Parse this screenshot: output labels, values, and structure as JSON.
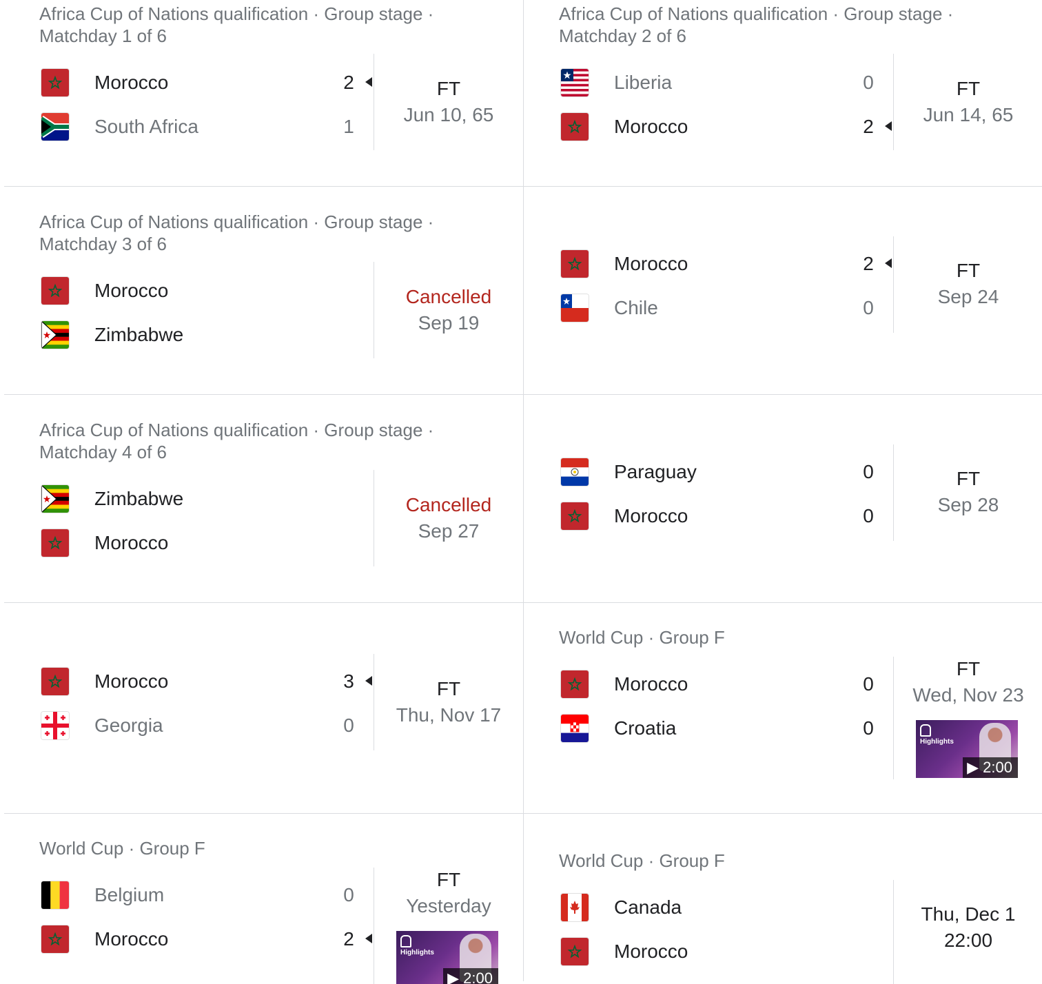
{
  "matches": [
    {
      "header_line1": "Africa Cup of Nations qualification · Group stage ·",
      "header_line2": "Matchday 1 of 6",
      "teams": [
        {
          "name": "Morocco",
          "score": "2",
          "flag": "morocco-flag",
          "winner": true
        },
        {
          "name": "South Africa",
          "score": "1",
          "flag": "south-africa-flag",
          "winner": false
        }
      ],
      "status": "FT",
      "date": "Jun 10, 65"
    },
    {
      "header_line1": "Africa Cup of Nations qualification · Group stage ·",
      "header_line2": "Matchday 2 of 6",
      "teams": [
        {
          "name": "Liberia",
          "score": "0",
          "flag": "liberia-flag",
          "winner": false
        },
        {
          "name": "Morocco",
          "score": "2",
          "flag": "morocco-flag",
          "winner": true
        }
      ],
      "status": "FT",
      "date": "Jun 14, 65"
    },
    {
      "header_line1": "Africa Cup of Nations qualification · Group stage ·",
      "header_line2": "Matchday 3 of 6",
      "teams": [
        {
          "name": "Morocco",
          "flag": "morocco-flag"
        },
        {
          "name": "Zimbabwe",
          "flag": "zimbabwe-flag"
        }
      ],
      "status": "Cancelled",
      "date": "Sep 19"
    },
    {
      "teams": [
        {
          "name": "Morocco",
          "score": "2",
          "flag": "morocco-flag",
          "winner": true
        },
        {
          "name": "Chile",
          "score": "0",
          "flag": "chile-flag",
          "winner": false
        }
      ],
      "status": "FT",
      "date": "Sep 24"
    },
    {
      "header_line1": "Africa Cup of Nations qualification · Group stage ·",
      "header_line2": "Matchday 4 of 6",
      "teams": [
        {
          "name": "Zimbabwe",
          "flag": "zimbabwe-flag"
        },
        {
          "name": "Morocco",
          "flag": "morocco-flag"
        }
      ],
      "status": "Cancelled",
      "date": "Sep 27"
    },
    {
      "teams": [
        {
          "name": "Paraguay",
          "score": "0",
          "flag": "paraguay-flag",
          "winner": false
        },
        {
          "name": "Morocco",
          "score": "0",
          "flag": "morocco-flag",
          "winner": false
        }
      ],
      "status": "FT",
      "date": "Sep 28"
    },
    {
      "teams": [
        {
          "name": "Morocco",
          "score": "3",
          "flag": "morocco-flag",
          "winner": true
        },
        {
          "name": "Georgia",
          "score": "0",
          "flag": "georgia-flag",
          "winner": false
        }
      ],
      "status": "FT",
      "date": "Thu, Nov 17"
    },
    {
      "header_line1": "World Cup · Group F",
      "teams": [
        {
          "name": "Morocco",
          "score": "0",
          "flag": "morocco-flag",
          "winner": false
        },
        {
          "name": "Croatia",
          "score": "0",
          "flag": "croatia-flag",
          "winner": false
        }
      ],
      "status": "FT",
      "date": "Wed, Nov 23",
      "highlights": {
        "label": "Highlights",
        "duration": "▶ 2:00"
      }
    },
    {
      "header_line1": "World Cup · Group F",
      "teams": [
        {
          "name": "Belgium",
          "score": "0",
          "flag": "belgium-flag",
          "winner": false
        },
        {
          "name": "Morocco",
          "score": "2",
          "flag": "morocco-flag",
          "winner": true
        }
      ],
      "status": "FT",
      "date": "Yesterday",
      "highlights": {
        "label": "Highlights",
        "duration": "▶ 2:00"
      }
    },
    {
      "header_line1": "World Cup · Group F",
      "teams": [
        {
          "name": "Canada",
          "flag": "canada-flag"
        },
        {
          "name": "Morocco",
          "flag": "morocco-flag"
        }
      ],
      "date": "Thu, Dec 1",
      "time": "22:00"
    }
  ]
}
